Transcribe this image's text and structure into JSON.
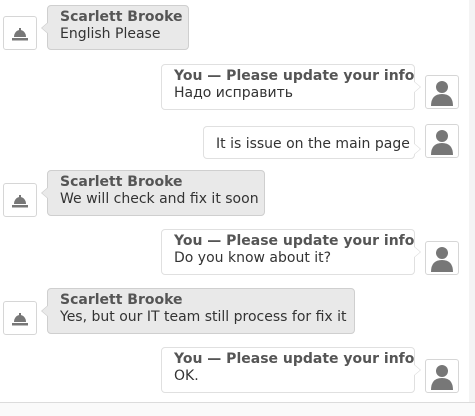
{
  "messages": [
    {
      "side": "agent",
      "sender": "Scarlett Brooke",
      "text": "English Please",
      "avatar": "bell-icon"
    },
    {
      "side": "me",
      "sender": "You — Please update your info",
      "text": "Надо исправить",
      "avatar": "user-icon"
    },
    {
      "side": "me",
      "sender": "",
      "text": "It is issue on the main page",
      "avatar": "user-icon"
    },
    {
      "side": "agent",
      "sender": "Scarlett Brooke",
      "text": "We will check and fix it soon",
      "avatar": "bell-icon"
    },
    {
      "side": "me",
      "sender": "You — Please update your info",
      "text": "Do you know about it?",
      "avatar": "user-icon"
    },
    {
      "side": "agent",
      "sender": "Scarlett Brooke",
      "text": "Yes, but our IT team still process for fix it",
      "avatar": "bell-icon"
    },
    {
      "side": "me",
      "sender": "You — Please update your info",
      "text": "OK.",
      "avatar": "user-icon"
    }
  ],
  "colors": {
    "agent_bubble": "#e9e9e9",
    "user_bubble": "#ffffff",
    "border": "#cfcfcf",
    "icon": "#777777"
  }
}
